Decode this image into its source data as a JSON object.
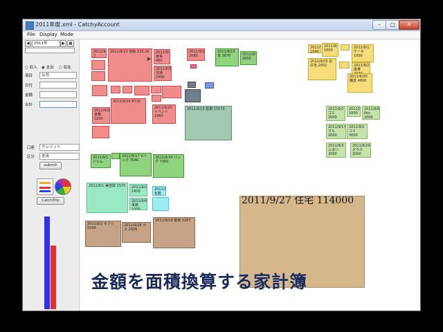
{
  "window": {
    "title": "2011年度.xml - CatchyAccount",
    "controls": {
      "minimize": "–",
      "maximize": "□",
      "close": "✕"
    }
  },
  "menu": [
    "File",
    "Display",
    "Mode"
  ],
  "sidebar": {
    "year": "2011年",
    "radio_options": [
      "収入",
      "支出",
      "収支"
    ],
    "field_labels": [
      "項目",
      "日付",
      "金額",
      "合計"
    ],
    "combo_value": "公共",
    "filter_labels": [
      "口座",
      "区分"
    ],
    "filter_values": [
      "クレジット",
      "支出"
    ],
    "submit_label": "submit",
    "catch_label": "CatchTrip",
    "bar_colors": [
      "#3030e8",
      "#e83030"
    ],
    "bar_levels": [
      0.96,
      0.66
    ]
  },
  "blocks": [
    {
      "id": "b1",
      "label": "2011/9/26 2",
      "color": "red"
    },
    {
      "id": "b2",
      "label": "2011/9/10 自転 133.28",
      "color": "red"
    },
    {
      "id": "b3",
      "label": "2011/9/11 食事 480",
      "color": "red"
    },
    {
      "id": "b4",
      "label": "2011/9/5 交通 2400",
      "color": "red"
    },
    {
      "id": "b5",
      "label": "2011/9/11 2080",
      "color": "red"
    },
    {
      "id": "b6",
      "label": "2011/9/15 本 3670",
      "color": "green"
    },
    {
      "id": "b7",
      "label": "2011/9/18 2800",
      "color": "green"
    },
    {
      "id": "b8",
      "label": "2011/9/24 8715",
      "color": "red"
    },
    {
      "id": "b9",
      "label": "2011/9/2 食費 2200",
      "color": "red"
    },
    {
      "id": "b10",
      "label": "2011/9/20 イベント 1960",
      "color": "red"
    },
    {
      "id": "b11",
      "label": "2011/9/13 駐車 15570",
      "color": "teal"
    },
    {
      "id": "b12",
      "label": "2011/9/1 ジャム",
      "color": "green"
    },
    {
      "id": "b13",
      "label": "2011/9/17 Vバッグ 7040",
      "color": "green"
    },
    {
      "id": "b14",
      "label": "2011/9/30 バッグ 7365",
      "color": "green"
    },
    {
      "id": "b15",
      "label": "2011/9/1 美容院 1570",
      "color": "mint"
    },
    {
      "id": "b16",
      "label": "2011/9/11 1900",
      "color": "mint"
    },
    {
      "id": "b17",
      "label": "2011/9/6 事務 1000",
      "color": "mint"
    },
    {
      "id": "b18",
      "label": "2011/9/3 化粧 2000",
      "color": "cyan"
    },
    {
      "id": "b19",
      "label": "2011/9/2 ギフト 5044",
      "color": "brown"
    },
    {
      "id": "b20",
      "label": "2011/9/28 ガス 2926",
      "color": "brown"
    },
    {
      "id": "b21",
      "label": "2011/9/18 電気 5287",
      "color": "brown"
    },
    {
      "id": "b22",
      "label": "2011/9/27 住宅 114000",
      "color": "tan"
    },
    {
      "id": "b23",
      "label": "2011/9/4 1040",
      "color": "yellow"
    },
    {
      "id": "b24",
      "label": "2011/9/7 1000",
      "color": "yellow"
    },
    {
      "id": "b25",
      "label": "2011/9/1 ケーキ 1000",
      "color": "yellow"
    },
    {
      "id": "b26",
      "label": "2011/9/20 お弁当 2002",
      "color": "yellow"
    },
    {
      "id": "b27",
      "label": "2011/9/28 携帯 2370",
      "color": "yellow"
    },
    {
      "id": "b28",
      "label": "2011/9/30 雑誌 4800",
      "color": "yellow"
    },
    {
      "id": "b29",
      "label": "2011/9/2 ゴミ 2000",
      "color": "lgreen"
    },
    {
      "id": "b30",
      "label": "2011/9/4 1000",
      "color": "lgreen"
    },
    {
      "id": "b31",
      "label": "2011/9/6 Pen 2000",
      "color": "lgreen"
    },
    {
      "id": "b32",
      "label": "2011/9/17 マル 2000",
      "color": "lgreen"
    },
    {
      "id": "b33",
      "label": "2011/9/2 コミ 3000",
      "color": "lgreen"
    },
    {
      "id": "b34",
      "label": "2011/9/3 ふるい 2000",
      "color": "lgreen"
    },
    {
      "id": "b35",
      "label": "2011/9/24 ガラス 2000",
      "color": "lgreen"
    }
  ],
  "caption": "金額を面積換算する家計簿"
}
